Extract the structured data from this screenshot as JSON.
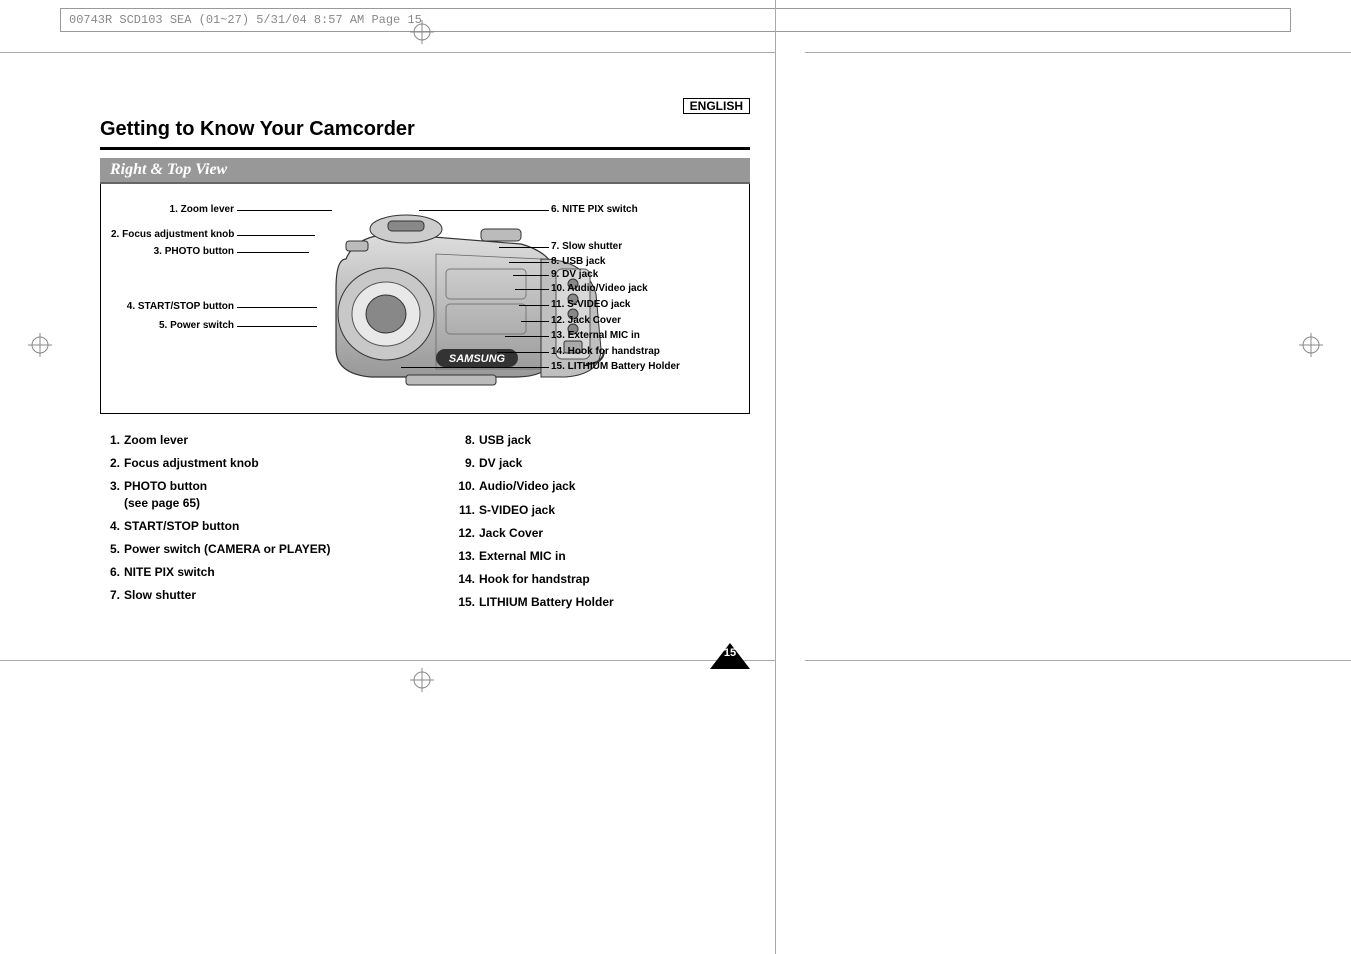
{
  "print_header": "00743R SCD103 SEA (01~27)  5/31/04 8:57 AM  Page 15",
  "language_label": "ENGLISH",
  "title": "Getting to Know Your Camcorder",
  "subhead": "Right & Top View",
  "diagram_labels": {
    "left": {
      "1": "1. Zoom lever",
      "2": "2. Focus adjustment knob",
      "3": "3. PHOTO button",
      "4": "4. START/STOP button",
      "5": "5. Power switch"
    },
    "right": {
      "6": "6. NITE PIX switch",
      "7": "7. Slow shutter",
      "8": "8. USB jack",
      "9": "9. DV jack",
      "10": "10. Audio/Video jack",
      "11": "11. S-VIDEO jack",
      "12": "12. Jack Cover",
      "13": "13. External MIC in",
      "14": "14. Hook for handstrap",
      "15": "15. LITHIUM Battery Holder"
    }
  },
  "legend": {
    "col_a": [
      {
        "num": "1.",
        "text": "Zoom lever"
      },
      {
        "num": "2.",
        "text": "Focus adjustment knob"
      },
      {
        "num": "3.",
        "text": "PHOTO button\n(see page 65)"
      },
      {
        "num": "4.",
        "text": "START/STOP button"
      },
      {
        "num": "5.",
        "text": "Power switch (CAMERA or PLAYER)"
      },
      {
        "num": "6.",
        "text": "NITE PIX switch"
      },
      {
        "num": "7.",
        "text": "Slow shutter"
      }
    ],
    "col_b": [
      {
        "num": "8.",
        "text": "USB jack"
      },
      {
        "num": "9.",
        "text": "DV jack"
      },
      {
        "num": "10.",
        "text": "Audio/Video jack"
      },
      {
        "num": "11.",
        "text": "S-VIDEO jack"
      },
      {
        "num": "12.",
        "text": "Jack Cover"
      },
      {
        "num": "13.",
        "text": "External MIC in"
      },
      {
        "num": "14.",
        "text": "Hook for handstrap"
      },
      {
        "num": "15.",
        "text": "LITHIUM Battery Holder"
      }
    ]
  },
  "brand_on_camcorder": "SAMSUNG",
  "page_number": "15"
}
